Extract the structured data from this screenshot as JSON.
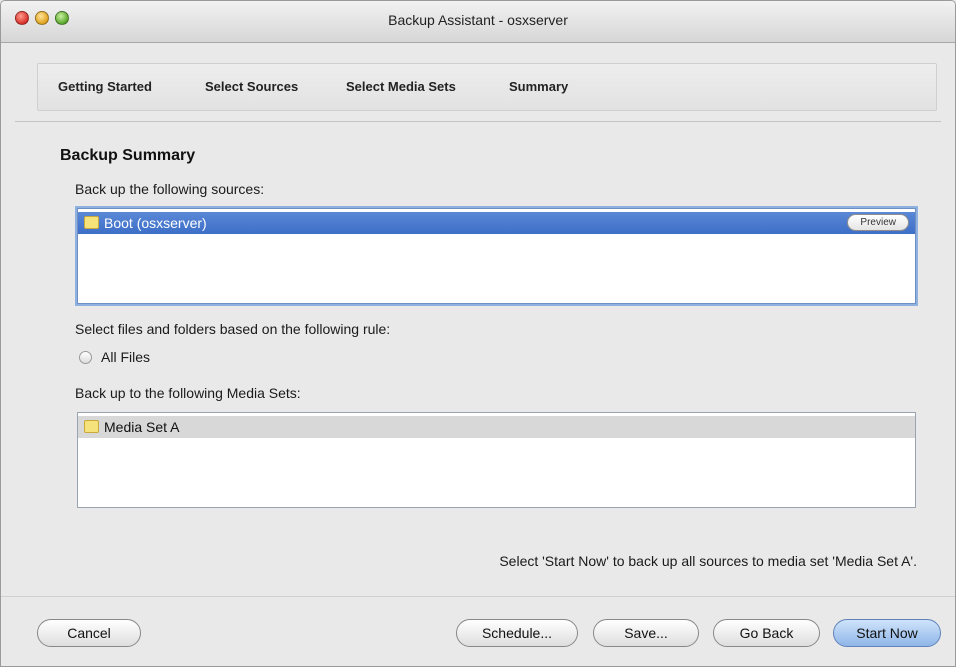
{
  "window": {
    "title": "Backup Assistant - osxserver"
  },
  "steps": [
    "Getting Started",
    "Select Sources",
    "Select Media Sets",
    "Summary"
  ],
  "summary": {
    "heading": "Backup Summary",
    "sources_label": "Back up the following sources:",
    "sources": [
      {
        "name": "Boot (osxserver)",
        "selected": true,
        "action": "Preview"
      }
    ],
    "rule_label": "Select files and folders based on the following rule:",
    "rule_option": "All Files",
    "media_sets_label": "Back up to the following Media Sets:",
    "media_sets": [
      {
        "name": "Media Set A"
      }
    ],
    "status_text": "Select 'Start Now' to back up all sources to media set 'Media Set A'."
  },
  "buttons": {
    "cancel": "Cancel",
    "schedule": "Schedule...",
    "save": "Save...",
    "go_back": "Go Back",
    "start_now": "Start Now"
  }
}
